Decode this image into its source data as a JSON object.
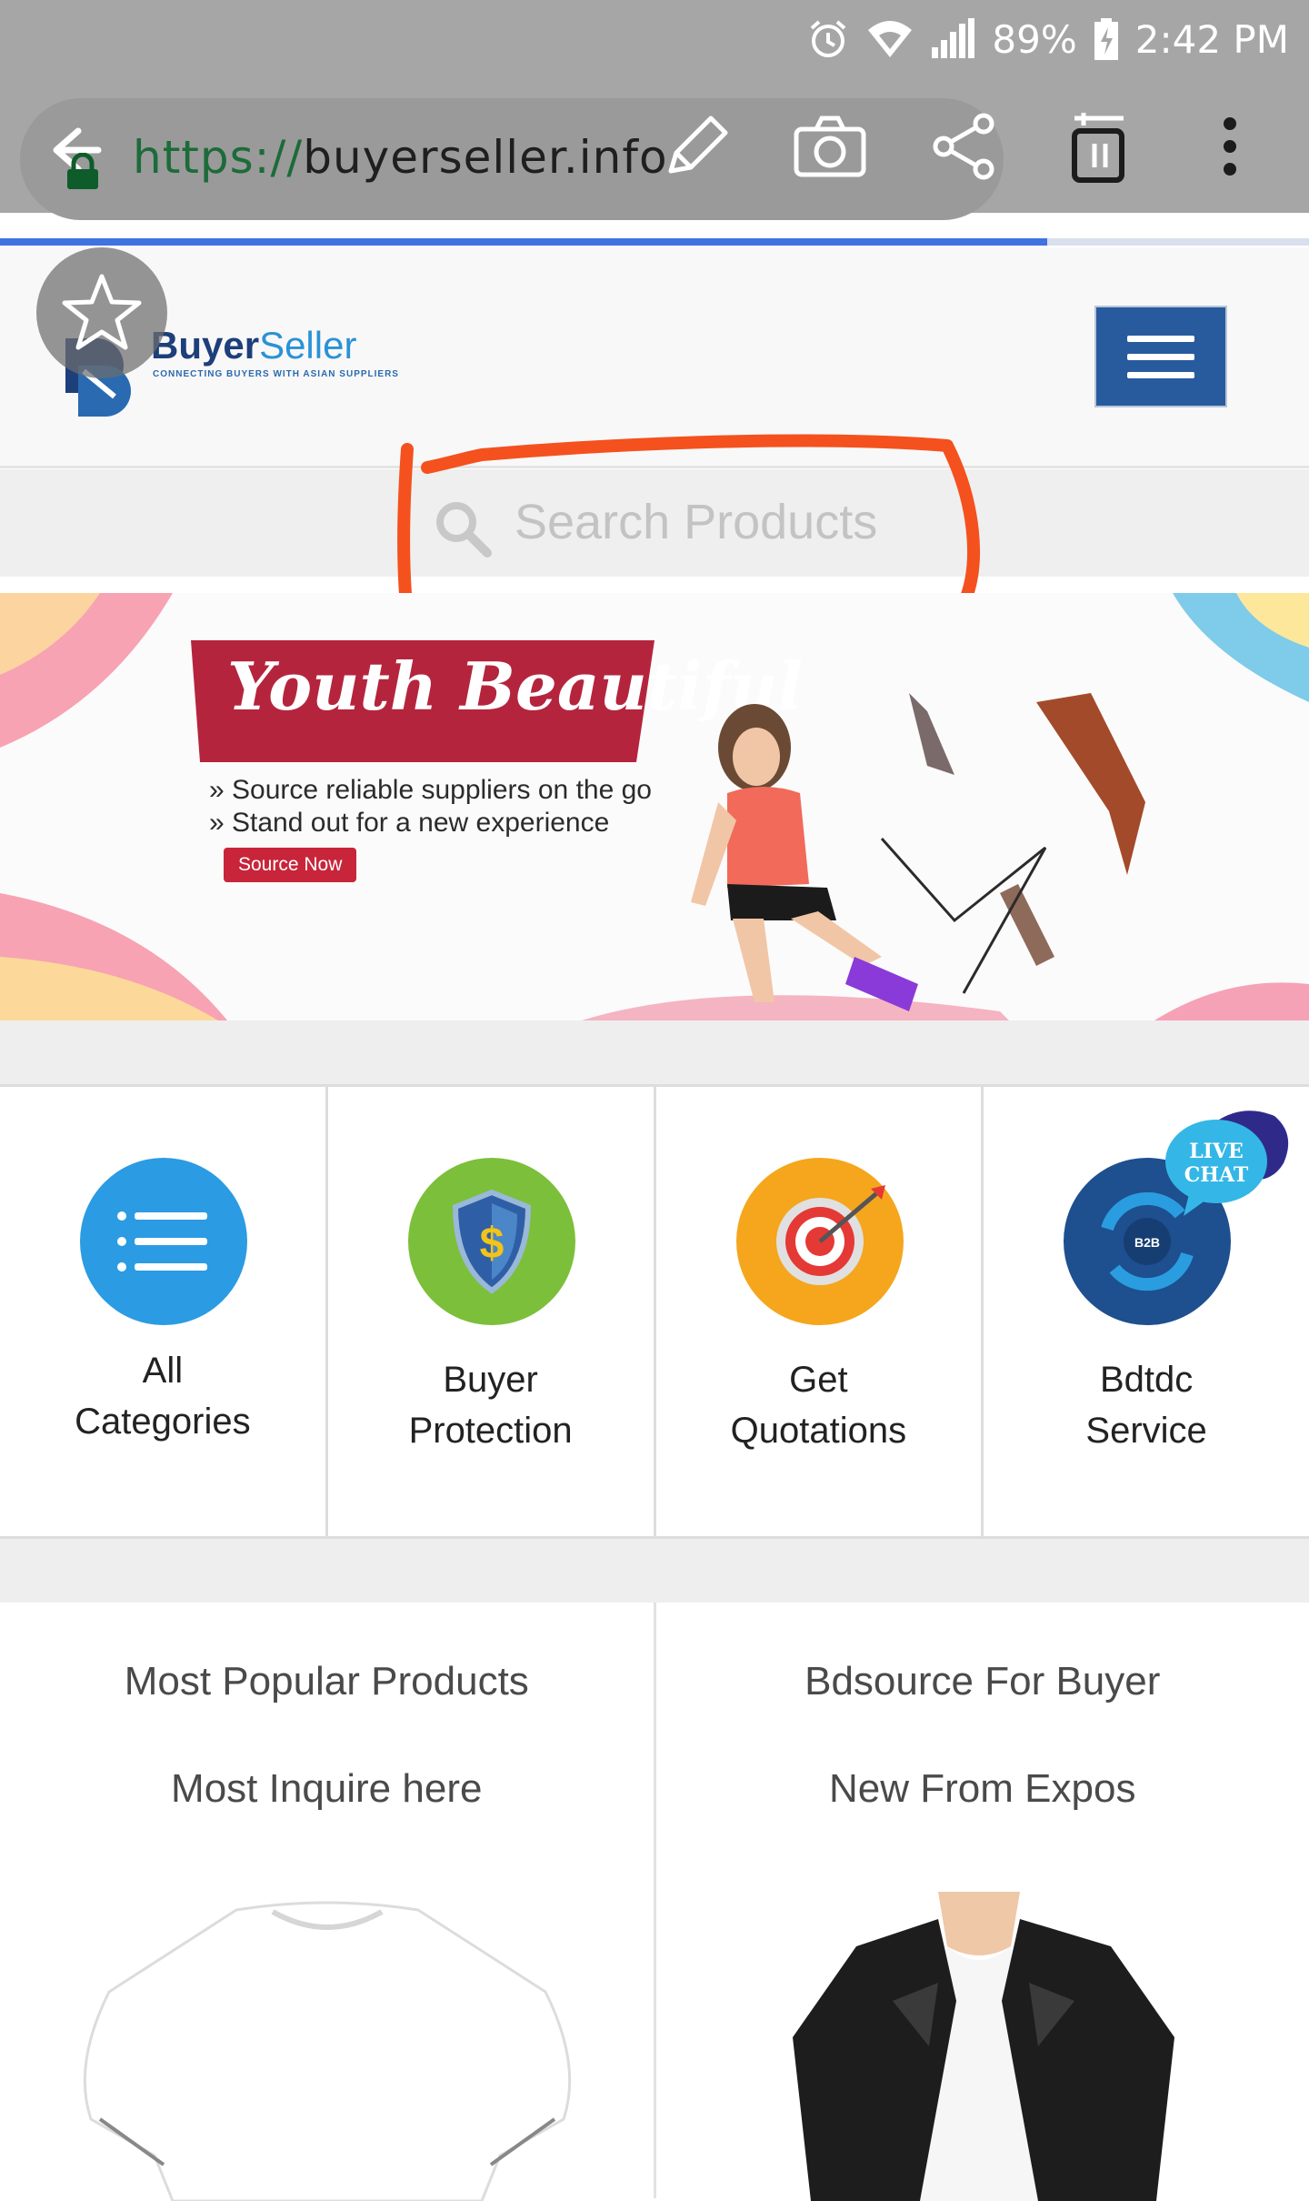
{
  "status_bar": {
    "battery": "89%",
    "time": "2:42 PM"
  },
  "browser": {
    "url_scheme": "https://",
    "url_host": "buyerseller.info",
    "page_load_progress": 0.8
  },
  "site": {
    "logo_word_a": "Buyer",
    "logo_word_b": "Seller",
    "logo_tagline": "CONNECTING BUYERS WITH ASIAN SUPPLIERS",
    "brand_color": "#285a9e"
  },
  "search": {
    "placeholder": "Search Products",
    "annotation_color": "#f4511e"
  },
  "banner": {
    "title": "Youth Beautiful",
    "bullets": [
      "» Source reliable suppliers on the go",
      "» Stand out for a new experience"
    ],
    "cta": "Source Now"
  },
  "tiles": [
    {
      "label": "All\nCategories",
      "icon": "list-icon",
      "color": "#2b9be3"
    },
    {
      "label": "Buyer\nProtection",
      "icon": "shield-dollar-icon",
      "color": "#7cbf3a"
    },
    {
      "label": "Get\nQuotations",
      "icon": "target-icon",
      "color": "#f5a61d"
    },
    {
      "label": "Bdtdc\nService",
      "icon": "b2b-icon",
      "color": "#1e4f8f",
      "badge": "LIVE CHAT"
    }
  ],
  "products": {
    "left": {
      "title": "Most Popular Products",
      "subtitle": "Most Inquire here",
      "image": "white-tshirt"
    },
    "right": {
      "title": "Bdsource For Buyer",
      "subtitle": "New From Expos",
      "image": "leather-jacket"
    }
  }
}
